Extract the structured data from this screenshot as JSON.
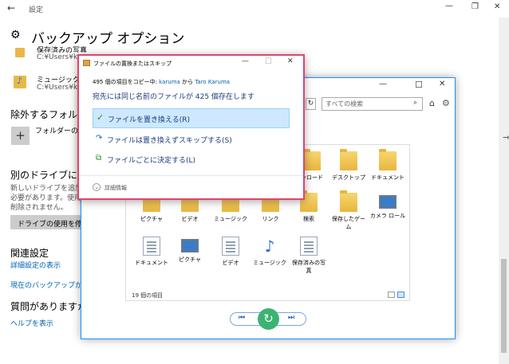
{
  "settings": {
    "titlebar": {
      "back_icon": "back-arrow-icon",
      "title": "設定",
      "minimize": "—",
      "maximize": "❐",
      "close": "✕"
    },
    "page_title": "バックアップ オプション",
    "folders": [
      {
        "name": "保存済みの写真",
        "path": "C:¥Users¥ka"
      },
      {
        "name": "ミュージック",
        "path": "C:¥Users¥ka"
      }
    ],
    "exclude_heading": "除外するフォルダー",
    "add_folder_label": "フォルダーの追",
    "other_drive_heading": "別のドライブにバッ",
    "other_drive_desc": [
      "新しいドライブを追加す",
      "必要があります。使用す",
      "削除されません。"
    ],
    "stop_drive_button": "ドライブの使用を停止",
    "related_heading": "関連設定",
    "advanced_link": "詳細設定の表示",
    "restore_link": "現在のバックアップから",
    "question_heading": "質問がありますか?",
    "help_link": "ヘルプを表示"
  },
  "restore_window": {
    "minimize": "—",
    "maximize": "☐",
    "close": "✕",
    "search_placeholder": "すべての検索",
    "item_count": "19 個の項目",
    "items_row1": [
      "ンロード",
      "デスクトップ",
      "ドキュメント"
    ],
    "items_row2": [
      "ピクチャ",
      "ビデオ",
      "ミュージック",
      "リンク",
      "検索",
      "保存したゲーム",
      "カメラ ロール"
    ],
    "items_row3": [
      "ドキュメント",
      "ピクチャ",
      "ビデオ",
      "ミュージック",
      "保存済みの写真"
    ]
  },
  "dialog": {
    "title": "ファイルの置換またはスキップ",
    "minimize": "—",
    "maximize": "☐",
    "close": "✕",
    "copy_prefix": "495 個の項目をコピー中: ",
    "source": "karuma",
    "copy_mid": " から ",
    "destination": "Taro Karuma",
    "conflict_text": "宛先には同じ名前のファイルが 425 個存在します",
    "option_replace": "ファイルを置き換える(R)",
    "option_skip": "ファイルは置き換えずスキップする(S)",
    "option_decide": "ファイルごとに決定する(L)",
    "details": "詳細情報"
  },
  "colors": {
    "accent": "#0063b1",
    "dialog_border": "#e0456e",
    "selected": "#cde8ff",
    "play_button": "#3cb371"
  }
}
